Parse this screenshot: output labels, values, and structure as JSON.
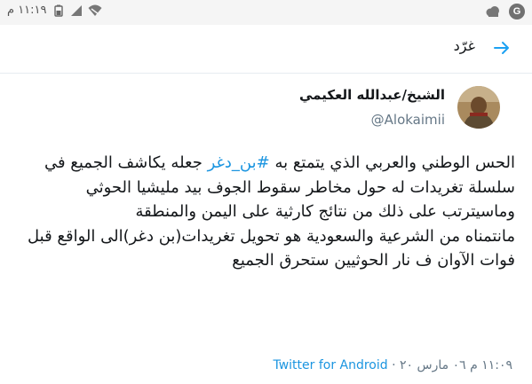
{
  "status_bar": {
    "time": "١١:١٩ م"
  },
  "header": {
    "title": "غرّد"
  },
  "tweet": {
    "display_name": "الشيخ/عبدالله العكيمي",
    "handle": "@Alokaimii",
    "text_before_hashtag": "الحس الوطني والعربي الذي يتمتع به ",
    "hashtag": "#بن_دغر",
    "text_after_hashtag": " جعله يكاشف الجميع في سلسلة تغريدات له حول مخاطر سقوط الجوف بيد مليشيا الحوثي وماسيترتب على ذلك من نتائج كارثية على اليمن والمنطقة",
    "paragraph2": "مانتمناه من الشرعية والسعودية هو تحويل تغريدات(بن دغر)الى الواقع قبل فوات الآوان ف نار الحوثيين ستحرق الجميع",
    "timestamp": "١١:٠٩ م ٠٦ مارس ٢٠ · ",
    "source": "Twitter for Android"
  },
  "colors": {
    "link": "#1b95e0",
    "secondary_text": "#657786",
    "accent_arrow": "#1da1f2"
  }
}
